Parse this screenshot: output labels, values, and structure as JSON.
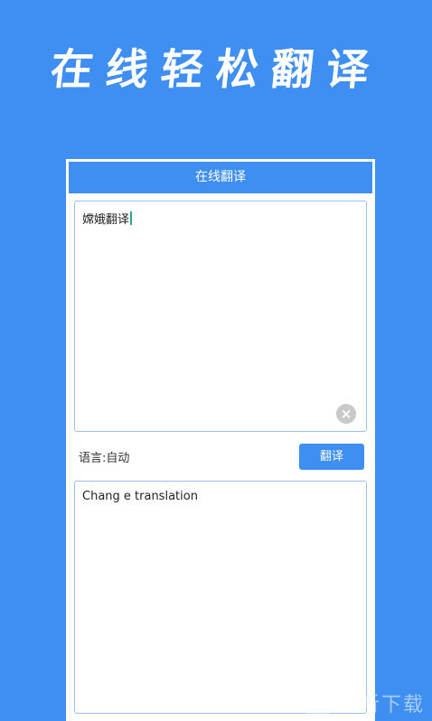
{
  "promo": {
    "title": "在线轻松翻译"
  },
  "app": {
    "title": "在线翻译",
    "source_text": "嫦娥翻译",
    "language_label": "语言:自动",
    "translate_button": "翻译",
    "result_text": "Chang e translation",
    "clear_icon": "close-icon"
  },
  "watermark": {
    "logo": "听",
    "text": "一听下载"
  }
}
